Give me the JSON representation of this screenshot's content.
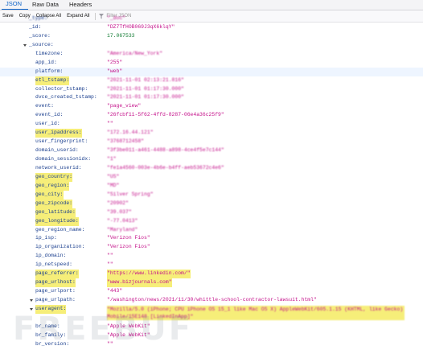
{
  "tabs": [
    "JSON",
    "Raw Data",
    "Headers"
  ],
  "toolbar": {
    "save": "Save",
    "copy": "Copy",
    "collapse_all": "Collapse All",
    "expand_all": "Expand All",
    "filter_placeholder": "Filter JSON"
  },
  "rows": [
    {
      "key": "_type:",
      "value": "\"_doc\"",
      "indent": 1,
      "kind": "s",
      "blur": true
    },
    {
      "key": "_id:",
      "value": "\"DZ7TfHOB069J3qX6klqY\"",
      "indent": 1,
      "kind": "s"
    },
    {
      "key": "_score:",
      "value": "17.067533",
      "indent": 1,
      "kind": "n"
    },
    {
      "key": "_source:",
      "value": "",
      "indent": 1,
      "kind": "toggle"
    },
    {
      "key": "timezone:",
      "value": "\"America/New_York\"",
      "indent": 2,
      "kind": "s",
      "blur": true
    },
    {
      "key": "app_id:",
      "value": "\"255\"",
      "indent": 2,
      "kind": "s"
    },
    {
      "key": "platform:",
      "value": "\"web\"",
      "indent": 2,
      "kind": "s",
      "hl": true
    },
    {
      "key": "etl_tstamp:",
      "value": "\"2021-11-01 02:13:21.816\"",
      "indent": 2,
      "kind": "s",
      "blur": true,
      "mark": true
    },
    {
      "key": "collector_tstamp:",
      "value": "\"2021-11-01 01:17:30.000\"",
      "indent": 2,
      "kind": "s",
      "blur": true
    },
    {
      "key": "dvce_created_tstamp:",
      "value": "\"2021-11-01 01:17:30.000\"",
      "indent": 2,
      "kind": "s",
      "blur": true
    },
    {
      "key": "event:",
      "value": "\"page_view\"",
      "indent": 2,
      "kind": "s"
    },
    {
      "key": "event_id:",
      "value": "\"26fcbf11-5f62-4ffd-8287-06e4a36c25f9\"",
      "indent": 2,
      "kind": "s"
    },
    {
      "key": "user_id:",
      "value": "\"\"",
      "indent": 2,
      "kind": "s"
    },
    {
      "key": "user_ipaddress:",
      "value": "\"172.16.44.121\"",
      "indent": 2,
      "kind": "s",
      "blur": true,
      "mark": true
    },
    {
      "key": "user_fingerprint:",
      "value": "\"3768712458\"",
      "indent": 2,
      "kind": "s",
      "blur": true
    },
    {
      "key": "domain_userid:",
      "value": "\"3f3be011-a461-4488-a898-4ce4f5e7c144\"",
      "indent": 2,
      "kind": "s",
      "blur": true
    },
    {
      "key": "domain_sessionidx:",
      "value": "\"1\"",
      "indent": 2,
      "kind": "s",
      "blur": true
    },
    {
      "key": "network_userid:",
      "value": "\"fe1a4560-003e-4b6e-b4ff-aeb53672c4e6\"",
      "indent": 2,
      "kind": "s",
      "blur": true
    },
    {
      "key": "geo_country:",
      "value": "\"US\"",
      "indent": 2,
      "kind": "s",
      "blur": true,
      "mark": true
    },
    {
      "key": "geo_region:",
      "value": "\"MD\"",
      "indent": 2,
      "kind": "s",
      "blur": true,
      "mark": true
    },
    {
      "key": "geo_city:",
      "value": "\"Silver Spring\"",
      "indent": 2,
      "kind": "s",
      "blur": true,
      "mark": true
    },
    {
      "key": "geo_zipcode:",
      "value": "\"20902\"",
      "indent": 2,
      "kind": "s",
      "blur": true,
      "mark": true
    },
    {
      "key": "geo_latitude:",
      "value": "\"39.037\"",
      "indent": 2,
      "kind": "s",
      "blur": true,
      "mark": true
    },
    {
      "key": "geo_longitude:",
      "value": "\"-77.0413\"",
      "indent": 2,
      "kind": "s",
      "blur": true,
      "mark": true
    },
    {
      "key": "geo_region_name:",
      "value": "\"Maryland\"",
      "indent": 2,
      "kind": "s",
      "blur": true
    },
    {
      "key": "ip_isp:",
      "value": "\"Verizon Fios\"",
      "indent": 2,
      "kind": "s"
    },
    {
      "key": "ip_organization:",
      "value": "\"Verizon Fios\"",
      "indent": 2,
      "kind": "s"
    },
    {
      "key": "ip_domain:",
      "value": "\"\"",
      "indent": 2,
      "kind": "s"
    },
    {
      "key": "ip_netspeed:",
      "value": "\"\"",
      "indent": 2,
      "kind": "s"
    },
    {
      "key": "page_referrer:",
      "value": "\"https://www.linkedin.com/\"",
      "indent": 2,
      "kind": "s",
      "mark": true,
      "vmark": true
    },
    {
      "key": "page_urlhost:",
      "value": "\"www.bizjournals.com\"",
      "indent": 2,
      "kind": "s",
      "mark": true,
      "vmark": true
    },
    {
      "key": "page_urlport:",
      "value": "\"443\"",
      "indent": 2,
      "kind": "s"
    },
    {
      "key": "page_urlpath:",
      "value": "\"/washington/news/2021/11/30/whittle-school-contractor-lawsuit.html\"",
      "indent": 2,
      "kind": "s",
      "toggle": true
    },
    {
      "key": "useragent:",
      "value": "\"Mozilla/5.0 (iPhone; CPU iPhone OS 15_1 like Mac OS X) AppleWebKit/605.1.15 (KHTML, like Gecko) Mobile/15E148 [LinkedInApp]\"",
      "indent": 2,
      "kind": "s",
      "toggle": true,
      "blur": true,
      "mark": true,
      "wrap": true
    },
    {
      "key": "br_name:",
      "value": "\"Apple WebKit\"",
      "indent": 2,
      "kind": "s"
    },
    {
      "key": "br_family:",
      "value": "\"Apple WebKit\"",
      "indent": 2,
      "kind": "s"
    },
    {
      "key": "br_version:",
      "value": "\"\"",
      "indent": 2,
      "kind": "s"
    }
  ],
  "watermark": "FREEBUF"
}
